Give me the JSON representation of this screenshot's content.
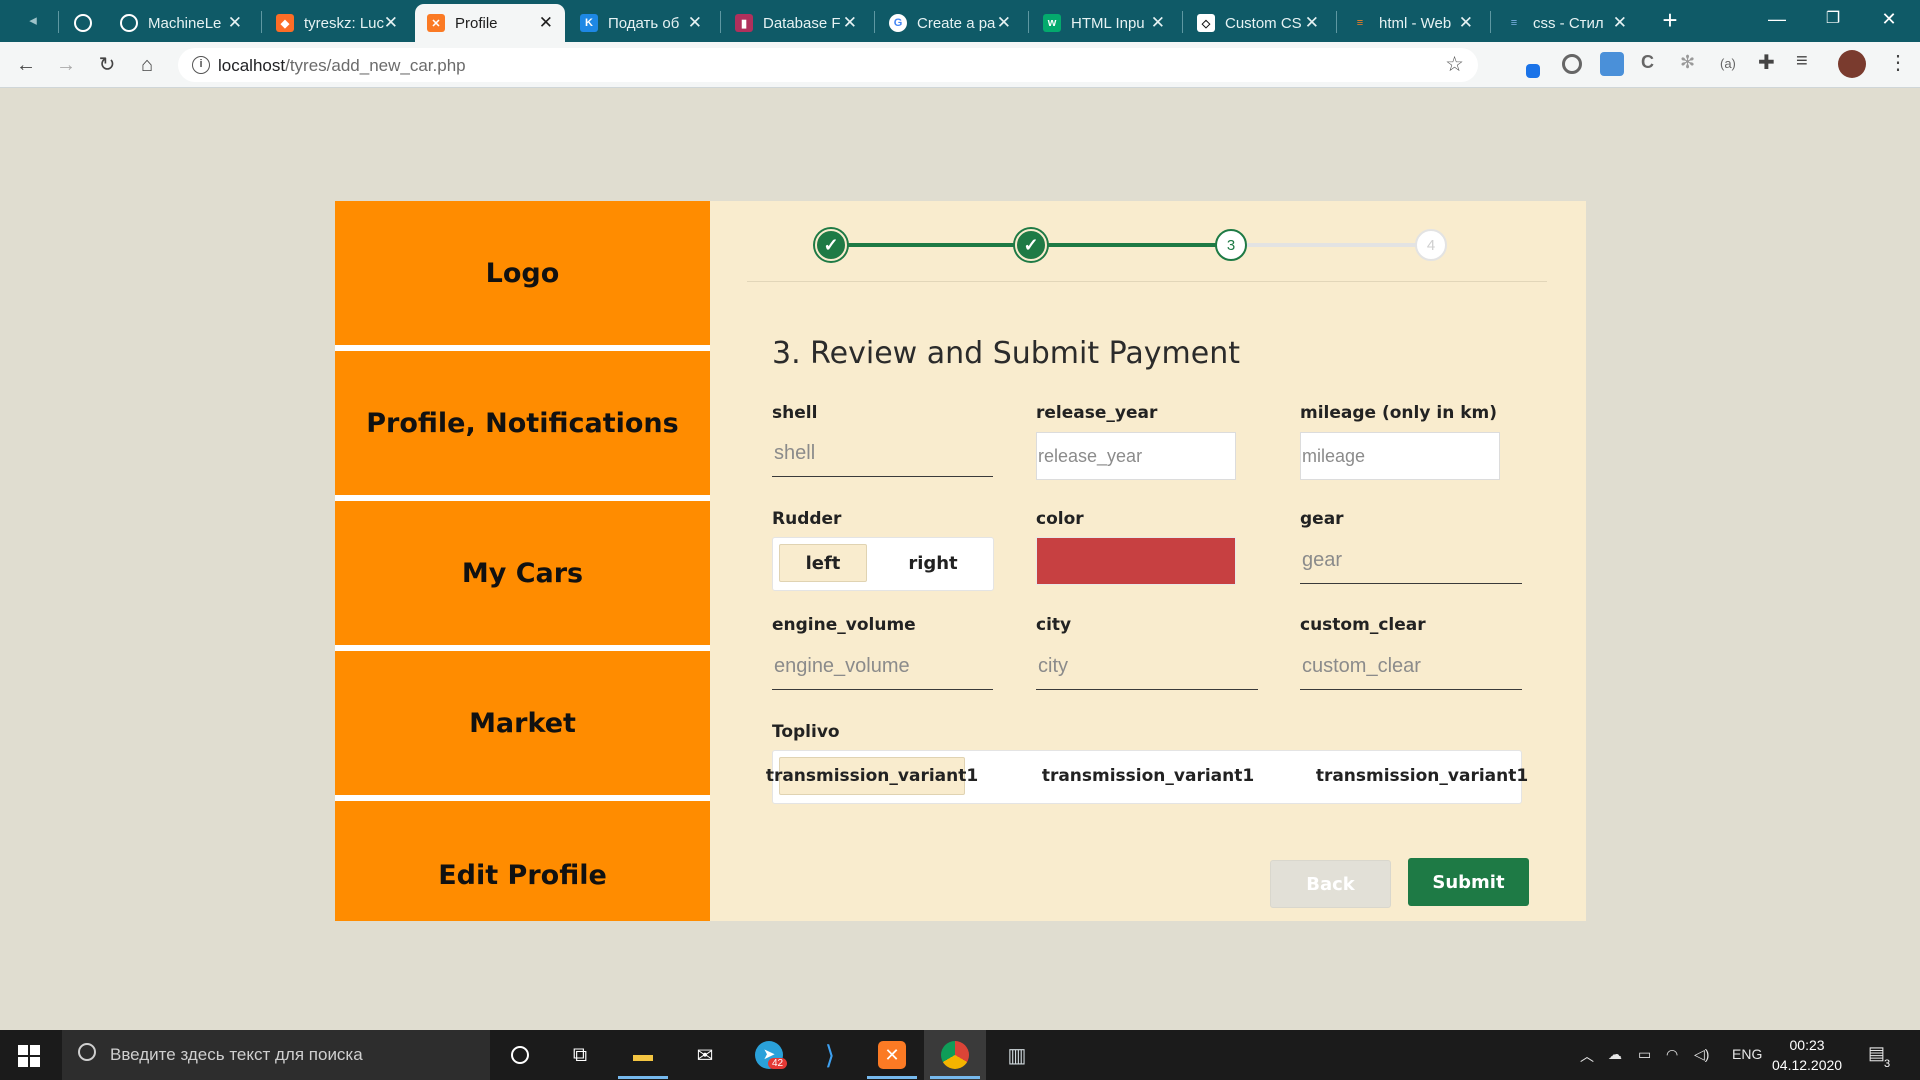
{
  "browser": {
    "tabs": [
      {
        "title": "MachineLe",
        "favicon": "github-icon",
        "color": "#24292e"
      },
      {
        "title": "tyreskz: Luc",
        "favicon": "gitlab-icon",
        "color": "#fc6d26"
      },
      {
        "title": "Profile",
        "favicon": "xampp-icon",
        "color": "#fb7a24"
      },
      {
        "title": "Подать об",
        "favicon": "k-icon",
        "color": "#1e88e5"
      },
      {
        "title": "Database F",
        "favicon": "database-icon",
        "color": "#b0305c"
      },
      {
        "title": "Create a pa",
        "favicon": "google-icon",
        "color": "#4285f4"
      },
      {
        "title": "HTML Inpu",
        "favicon": "w3schools-icon",
        "color": "#04aa6d"
      },
      {
        "title": "Custom CS",
        "favicon": "codepen-icon",
        "color": "#111111"
      },
      {
        "title": "html - Web",
        "favicon": "stackoverflow-icon",
        "color": "#f48024"
      },
      {
        "title": "css - Стил",
        "favicon": "stackoverflow-ru-icon",
        "color": "#1f6cb0"
      }
    ],
    "url_host": "localhost",
    "url_path": "/tyres/add_new_car.php"
  },
  "sidebar": {
    "items": [
      "Logo",
      "Profile, Notifications",
      "My Cars",
      "Market",
      "Edit Profile"
    ]
  },
  "stepper": {
    "steps": [
      {
        "label": "✓",
        "state": "done"
      },
      {
        "label": "✓",
        "state": "done"
      },
      {
        "label": "3",
        "state": "current"
      },
      {
        "label": "4",
        "state": "todo"
      }
    ]
  },
  "form": {
    "title": "3. Review and Submit Payment",
    "shell": {
      "label": "shell",
      "placeholder": "shell"
    },
    "release_year": {
      "label": "release_year",
      "placeholder": "release_year"
    },
    "mileage": {
      "label": "mileage (only in km)",
      "placeholder": "mileage"
    },
    "rudder": {
      "label": "Rudder",
      "options": [
        "left",
        "right"
      ],
      "selected": "left"
    },
    "color": {
      "label": "color",
      "value": "#c74041"
    },
    "gear": {
      "label": "gear",
      "placeholder": "gear"
    },
    "engine_volume": {
      "label": "engine_volume",
      "placeholder": "engine_volume"
    },
    "city": {
      "label": "city",
      "placeholder": "city"
    },
    "custom_clear": {
      "label": "custom_clear",
      "placeholder": "custom_clear"
    },
    "toplivo": {
      "label": "Toplivo",
      "options": [
        "transmission_variant1",
        "transmission_variant1",
        "transmission_variant1"
      ],
      "selected_index": 0
    },
    "back_label": "Back",
    "submit_label": "Submit"
  },
  "taskbar": {
    "search_placeholder": "Введите здесь текст для поиска",
    "telegram_badge": "42",
    "lang": "ENG",
    "time": "00:23",
    "date": "04.12.2020",
    "notifications": "3"
  }
}
